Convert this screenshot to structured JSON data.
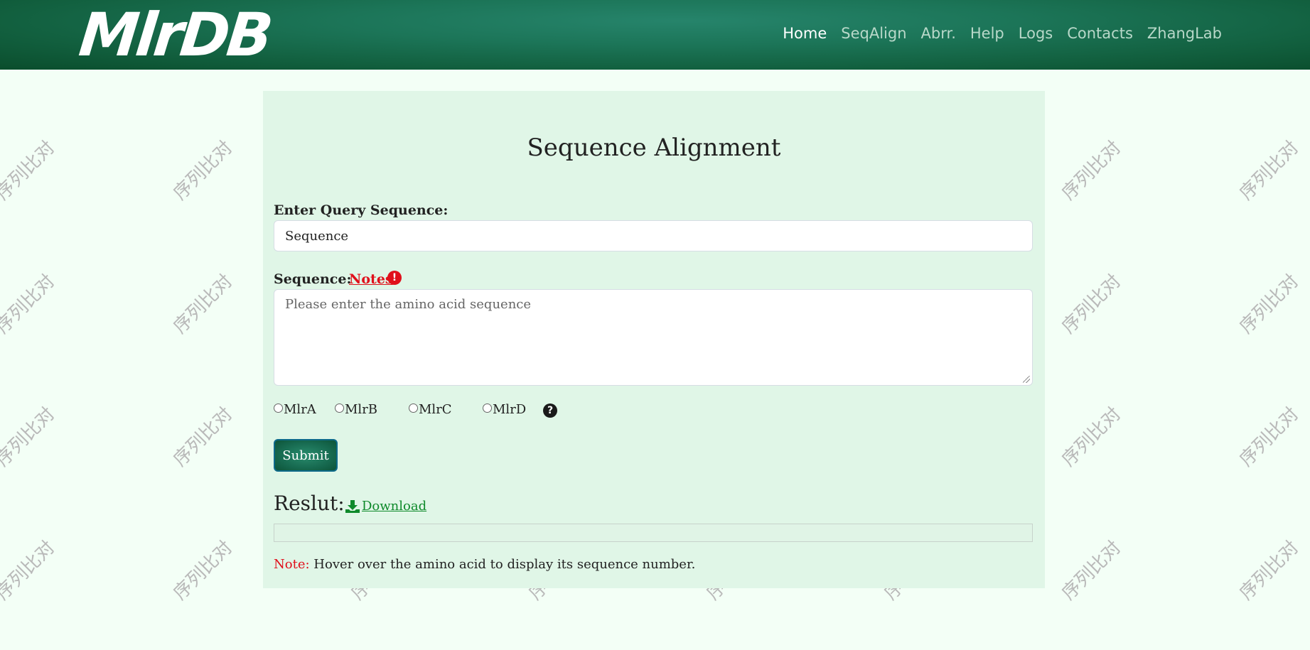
{
  "navbar": {
    "logo": "MlrDB",
    "links": [
      "Home",
      "SeqAlign",
      "Abrr.",
      "Help",
      "Logs",
      "Contacts",
      "ZhangLab"
    ],
    "active": "Home"
  },
  "watermark": {
    "text": "序列比对"
  },
  "page": {
    "title": "Sequence Alignment",
    "query_label": "Enter Query Sequence:",
    "query_value": "Sequence",
    "sequence_label": "Sequence:",
    "notes_link": "Notes",
    "sequence_placeholder": "Please enter the amino acid sequence",
    "radios": [
      "MlrA",
      "MlrB",
      "MlrC",
      "MlrD"
    ],
    "submit_label": "Submit",
    "result_label": "Reslut:",
    "download_label": "Download",
    "note_prefix": "Note:",
    "note_text": "Hover over the amino acid to display its sequence number."
  },
  "colors": {
    "navbar": "#1c7558",
    "page_bg": "#f3fff6",
    "panel_bg": "#e0f6e7",
    "notes_red": "#e0101b",
    "download_green": "#0f8a2b"
  },
  "icons": [
    "exclamation-circle-icon",
    "question-circle-icon",
    "download-icon"
  ]
}
